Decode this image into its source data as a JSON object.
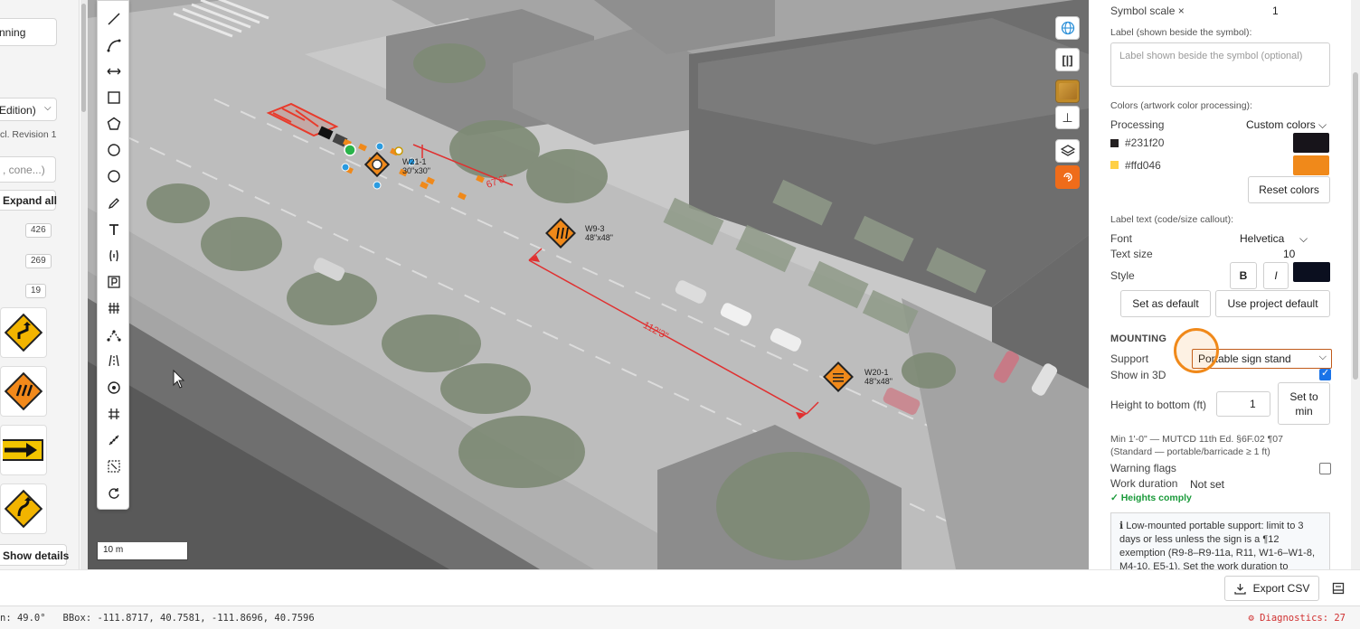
{
  "left_panel": {
    "planning_label": "nning",
    "edition_select": "Edition)",
    "revision_text": "cl. Revision 1",
    "search_placeholder": ", cone...)",
    "expand_all_label": "Expand all",
    "counts": [
      "426",
      "269",
      "19"
    ],
    "show_details_label": "Show details"
  },
  "map": {
    "sign_labels": [
      {
        "code": "W21-1",
        "size": "30\"x30\""
      },
      {
        "code": "W9-3",
        "size": "48\"x48\""
      },
      {
        "code": "W20-1",
        "size": "48\"x48\""
      }
    ],
    "dimensions": [
      "67'6\"",
      "112'3\""
    ],
    "scale_label": "10 m"
  },
  "right_panel": {
    "symbol_scale_label": "Symbol scale ×",
    "symbol_scale_value": "1",
    "label_field_label": "Label (shown beside the symbol):",
    "label_placeholder": "Label shown beside the symbol (optional)",
    "colors_heading": "Colors (artwork color processing):",
    "processing_label": "Processing",
    "processing_value": "Custom colors",
    "color_1_hex": "#231f20",
    "color_2_hex": "#ffd046",
    "color_1_replace": "#17141a",
    "color_2_replace": "#f0891a",
    "reset_colors_label": "Reset colors",
    "label_text_heading": "Label text (code/size callout):",
    "font_label": "Font",
    "font_value": "Helvetica",
    "text_size_label": "Text size",
    "text_size_value": "10",
    "style_label": "Style",
    "bold_label": "B",
    "italic_label": "I",
    "style_color": "#0b0f1f",
    "set_default_label": "Set as default",
    "use_project_default_label": "Use project default",
    "mounting_heading": "MOUNTING",
    "support_label": "Support",
    "support_value": "Portable sign stand",
    "show_3d_label": "Show in 3D",
    "height_label": "Height to bottom (ft)",
    "height_value": "1",
    "set_to_min_label": "Set to min",
    "min_note": "Min 1'-0\" — MUTCD 11th Ed. §6F.02 ¶07",
    "min_note_2": "(Standard — portable/barricade ≥ 1 ft)",
    "warning_flags_label": "Warning flags",
    "work_duration_label": "Work duration",
    "work_duration_value": "Not set",
    "heights_comply": "✓ Heights comply",
    "info_text": "ℹ Low-mounted portable support: limit to 3 days or less unless the sign is a ¶12 exemption (R9-8–R9-11a, R11, W1-6–W1-8, M4-10, E5-1). Set the work duration to"
  },
  "bottom": {
    "export_csv_label": "Export CSV"
  },
  "status": {
    "left_text": "n: 49.0°   BBox: -111.8717, 40.7581, -111.8696, 40.7596",
    "diagnostics": "⚙ Diagnostics: 27"
  }
}
